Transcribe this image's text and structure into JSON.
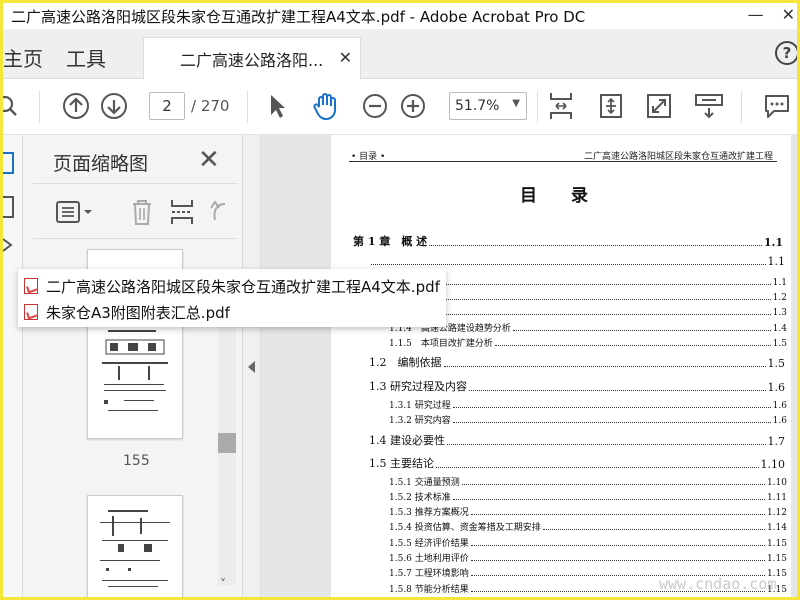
{
  "window": {
    "title": "二广高速公路洛阳城区段朱家仓互通改扩建工程A4文本.pdf - Adobe Acrobat Pro DC",
    "minimize": "—",
    "close": "✕"
  },
  "tabs": {
    "home": "主页",
    "tools": "工具",
    "document": "二广高速公路洛阳...",
    "document_close": "✕",
    "help": "?"
  },
  "toolbar": {
    "page_current": "2",
    "page_total": "/ 270",
    "zoom": "51.7%"
  },
  "thumbnails": {
    "title": "页面缩略图",
    "close": "✕",
    "pages": [
      {
        "number": "155"
      }
    ]
  },
  "recent_files": [
    {
      "name": "二广高速公路洛阳城区段朱家仓互通改扩建工程A4文本.pdf"
    },
    {
      "name": "朱家仓A3附图附表汇总.pdf"
    }
  ],
  "document": {
    "header_left": "• 目录 •",
    "header_right": "二广高速公路洛阳城区段朱家仓互通改扩建工程",
    "toc_title": "目 录",
    "toc": [
      {
        "label": "第 1 章　概 述",
        "page": "1.1",
        "level": 0
      },
      {
        "label": "",
        "page": "1.1",
        "level": 1
      },
      {
        "label": "位背景",
        "page": "1.1",
        "level": 2
      },
      {
        "label": "济背景",
        "page": "1.2",
        "level": 2
      },
      {
        "label": "划背景",
        "page": "1.3",
        "level": 2
      },
      {
        "label": "1.1.4　高速公路建设趋势分析",
        "page": "1.4",
        "level": 2
      },
      {
        "label": "1.1.5　本项目改扩建分析",
        "page": "1.5",
        "level": 2
      },
      {
        "label": "1.2　编制依据",
        "page": "1.5",
        "level": 1
      },
      {
        "label": "1.3 研究过程及内容",
        "page": "1.6",
        "level": 1
      },
      {
        "label": "1.3.1 研究过程",
        "page": "1.6",
        "level": 2
      },
      {
        "label": "1.3.2 研究内容",
        "page": "1.6",
        "level": 2
      },
      {
        "label": "1.4 建设必要性",
        "page": "1.7",
        "level": 1
      },
      {
        "label": "1.5 主要结论",
        "page": "1.10",
        "level": 1
      },
      {
        "label": "1.5.1 交通量预测",
        "page": "1.10",
        "level": 2
      },
      {
        "label": "1.5.2 技术标准",
        "page": "1.11",
        "level": 2
      },
      {
        "label": "1.5.3 推荐方案概况",
        "page": "1.12",
        "level": 2
      },
      {
        "label": "1.5.4 投资估算、资金筹措及工期安排",
        "page": "1.14",
        "level": 2
      },
      {
        "label": "1.5.5 经济评价结果",
        "page": "1.15",
        "level": 2
      },
      {
        "label": "1.5.6 土地利用评价",
        "page": "1.15",
        "level": 2
      },
      {
        "label": "1.5.7 工程环境影响",
        "page": "1.15",
        "level": 2
      },
      {
        "label": "1.5.8 节能分析结果",
        "page": "1.15",
        "level": 2
      }
    ]
  },
  "watermark": "www.cndao.com",
  "colors": {
    "accent": "#1a73c8",
    "frame": "#f5e63a",
    "pdf_red": "#cc3333"
  }
}
